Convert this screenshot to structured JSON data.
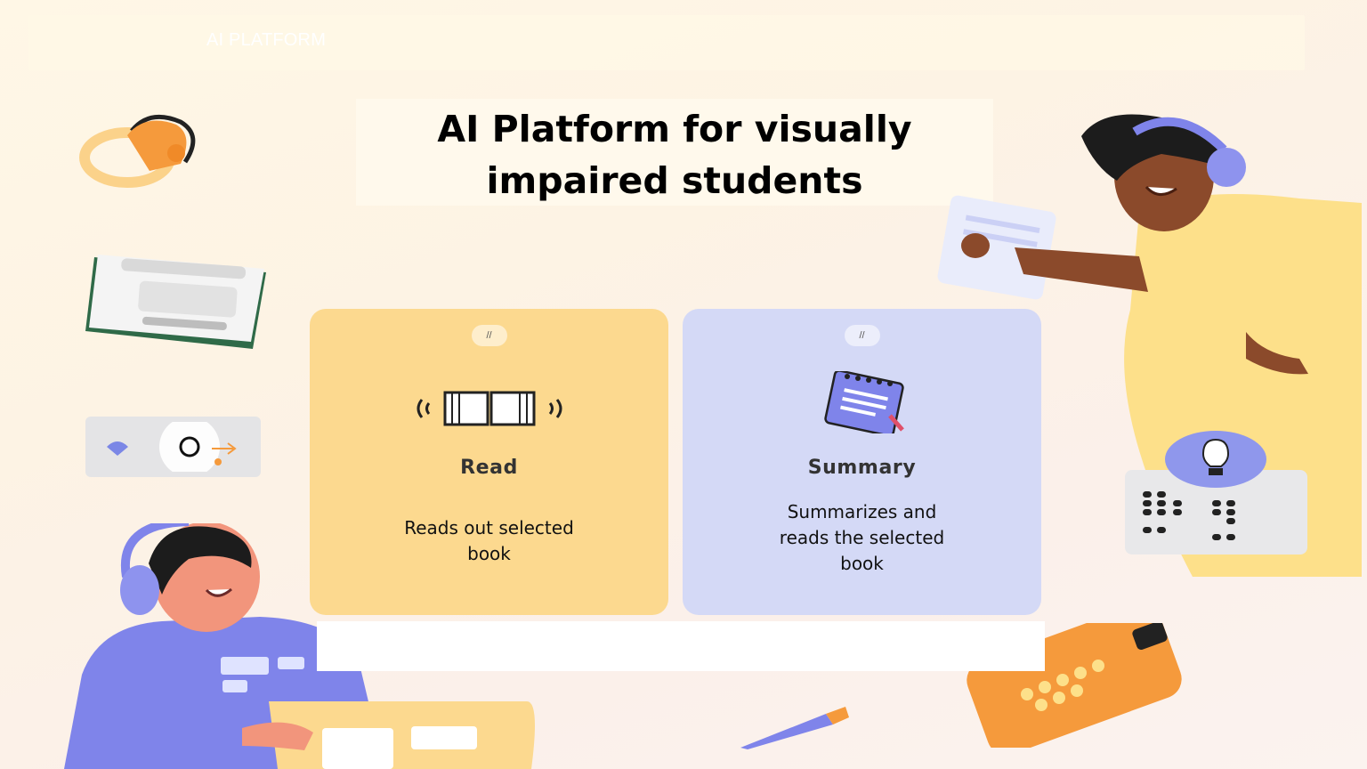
{
  "topbar": {
    "brand": "AI PLATFORM"
  },
  "page": {
    "title_line1": "AI Platform for visually",
    "title_line2": "impaired students"
  },
  "cards": [
    {
      "id": "read",
      "heading": "Read",
      "description": "Reads out selected book",
      "icon": "open-book-speaker-icon",
      "color": "#fcd98f"
    },
    {
      "id": "summary",
      "heading": "Summary",
      "description": "Summarizes and reads the selected book",
      "icon": "notepad-icon",
      "color": "#d4d9f6"
    }
  ],
  "illustrations": {
    "right_person": "student-with-headphones-illustration",
    "left_person": "student-with-headphones-laptop-illustration",
    "braille_panel": "braille-dots-panel",
    "lightbulb": "lightbulb-icon",
    "pencil": "pencil-icon",
    "tablet": "braille-tablet-icon"
  }
}
